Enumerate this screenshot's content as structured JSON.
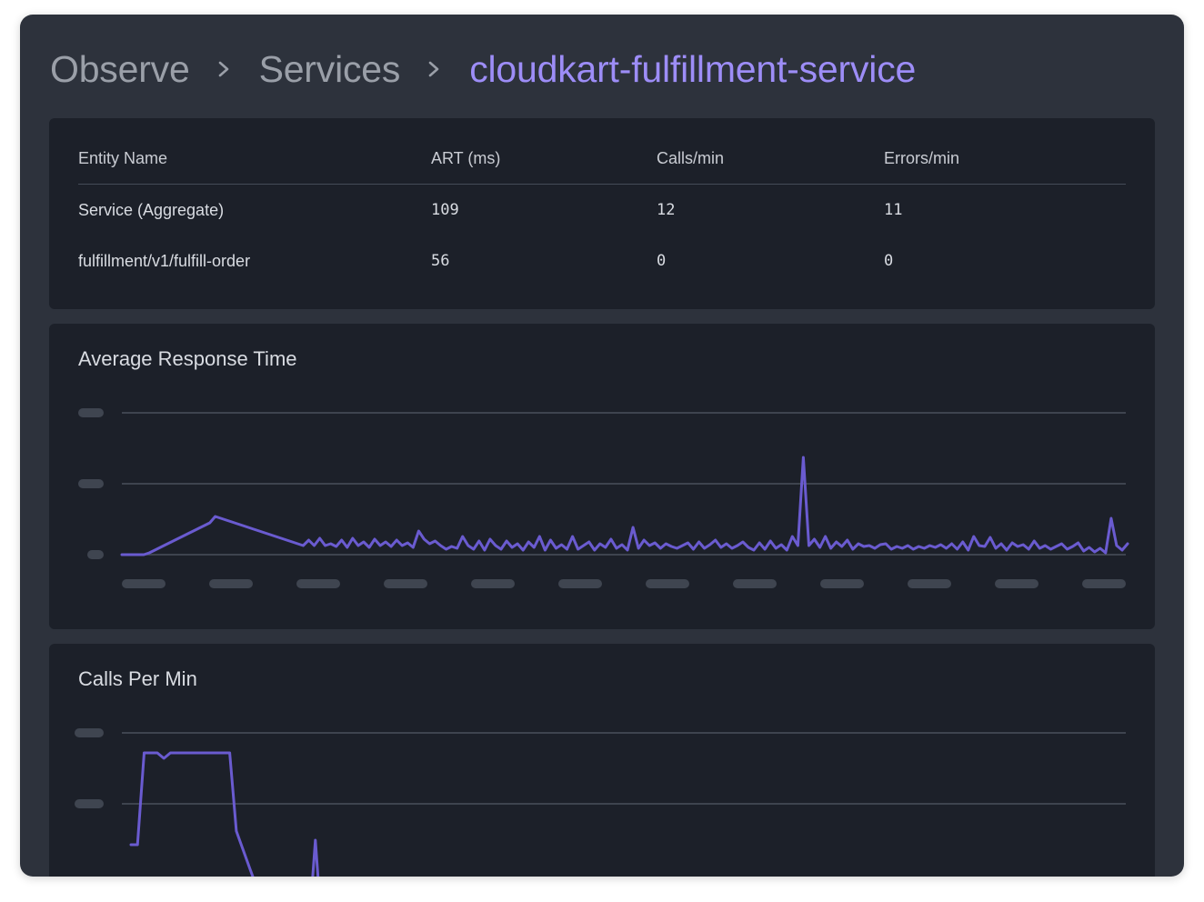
{
  "breadcrumb": {
    "items": [
      "Observe",
      "Services"
    ],
    "current": "cloudkart-fulfillment-service"
  },
  "table": {
    "headers": [
      "Entity Name",
      "ART (ms)",
      "Calls/min",
      "Errors/min"
    ],
    "rows": [
      [
        "Service (Aggregate)",
        "109",
        "12",
        "11"
      ],
      [
        "fulfillment/v1/fulfill-order",
        "56",
        "0",
        "0"
      ]
    ]
  },
  "charts": {
    "response_time_title": "Average Response Time",
    "calls_title": "Calls Per Min"
  },
  "colors": {
    "accent": "#9d8df7",
    "series": "#6a5bd0",
    "panel": "#1c2029",
    "window": "#2d323c"
  },
  "chart_data": [
    {
      "type": "line",
      "title": "Average Response Time",
      "series": [
        {
          "values": [
            0.0,
            0.0,
            0.0,
            0.0,
            0.0,
            0.02,
            0.05,
            0.08,
            0.11,
            0.14,
            0.17,
            0.2,
            0.23,
            0.26,
            0.29,
            0.32,
            0.35,
            0.42,
            0.4,
            0.38,
            0.36,
            0.34,
            0.32,
            0.3,
            0.28,
            0.26,
            0.24,
            0.22,
            0.2,
            0.18,
            0.16,
            0.14,
            0.12,
            0.1,
            0.16,
            0.1,
            0.18,
            0.1,
            0.12,
            0.09,
            0.16,
            0.08,
            0.18,
            0.1,
            0.14,
            0.08,
            0.17,
            0.1,
            0.14,
            0.09,
            0.16,
            0.1,
            0.13,
            0.08,
            0.26,
            0.17,
            0.12,
            0.15,
            0.1,
            0.06,
            0.09,
            0.07,
            0.2,
            0.1,
            0.06,
            0.15,
            0.05,
            0.17,
            0.1,
            0.06,
            0.15,
            0.08,
            0.12,
            0.05,
            0.14,
            0.08,
            0.2,
            0.05,
            0.16,
            0.07,
            0.11,
            0.06,
            0.2,
            0.06,
            0.1,
            0.14,
            0.05,
            0.12,
            0.08,
            0.17,
            0.07,
            0.11,
            0.05,
            0.3,
            0.07,
            0.16,
            0.1,
            0.13,
            0.07,
            0.12,
            0.09,
            0.07,
            0.1,
            0.13,
            0.06,
            0.14,
            0.07,
            0.11,
            0.16,
            0.08,
            0.12,
            0.07,
            0.1,
            0.14,
            0.08,
            0.05,
            0.13,
            0.06,
            0.15,
            0.07,
            0.11,
            0.05,
            0.2,
            0.1,
            1.07,
            0.1,
            0.17,
            0.08,
            0.2,
            0.07,
            0.14,
            0.09,
            0.16,
            0.06,
            0.12,
            0.09,
            0.1,
            0.07,
            0.11,
            0.12,
            0.06,
            0.09,
            0.07,
            0.1,
            0.06,
            0.09,
            0.07,
            0.1,
            0.08,
            0.11,
            0.07,
            0.12,
            0.06,
            0.14,
            0.05,
            0.2,
            0.1,
            0.09,
            0.19,
            0.07,
            0.12,
            0.05,
            0.13,
            0.09,
            0.11,
            0.06,
            0.15,
            0.07,
            0.1,
            0.06,
            0.09,
            0.12,
            0.06,
            0.09,
            0.13,
            0.04,
            0.08,
            0.03,
            0.07,
            0.02,
            0.4,
            0.1,
            0.05,
            0.12
          ]
        }
      ]
    },
    {
      "type": "line",
      "title": "Calls Per Min",
      "series": [
        {
          "values": [
            0.95,
            0.95,
            1.96,
            1.96,
            1.96,
            1.9,
            1.96,
            1.96,
            1.96,
            1.96,
            1.96,
            1.96,
            1.96,
            1.96,
            1.96,
            1.96,
            1.1,
            0.9,
            0.7,
            0.5,
            0.3,
            0.1,
            0.0,
            0.0,
            0.0,
            0.0,
            0.0,
            0.0,
            1.0,
            0.0
          ]
        }
      ]
    }
  ]
}
